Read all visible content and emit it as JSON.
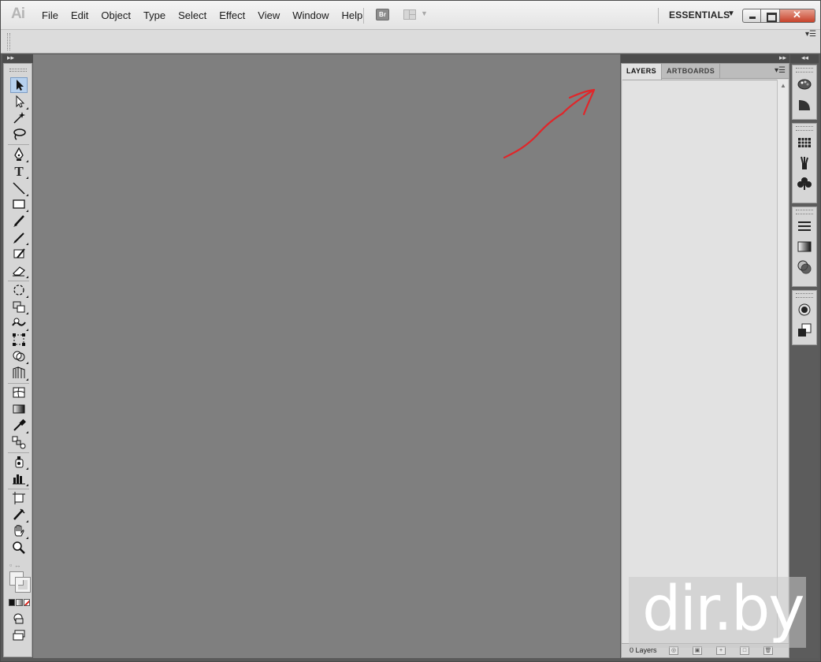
{
  "app": {
    "logo": "Ai",
    "workspace": "ESSENTIALS"
  },
  "menu": [
    "File",
    "Edit",
    "Object",
    "Type",
    "Select",
    "Effect",
    "View",
    "Window",
    "Help"
  ],
  "bridge_button": "Br",
  "window_buttons": {
    "close": "✕"
  },
  "panel": {
    "tabs": [
      "LAYERS",
      "ARTBOARDS"
    ],
    "active_tab": "LAYERS",
    "layers_count": "0 Layers"
  },
  "tools": [
    "selection-tool",
    "direct-selection-tool",
    "magic-wand-tool",
    "lasso-tool",
    "pen-tool",
    "type-tool",
    "line-segment-tool",
    "rectangle-tool",
    "paintbrush-tool",
    "pencil-tool",
    "blob-brush-tool",
    "eraser-tool",
    "rotate-tool",
    "scale-tool",
    "warp-tool",
    "free-transform-tool",
    "shape-builder-tool",
    "perspective-grid-tool",
    "mesh-tool",
    "gradient-tool",
    "eyedropper-tool",
    "blend-tool",
    "symbol-sprayer-tool",
    "column-graph-tool",
    "artboard-tool",
    "slice-tool",
    "hand-tool",
    "zoom-tool"
  ],
  "right_dock_icons": [
    "color-icon",
    "color-guide-icon",
    "swatches-icon",
    "brushes-icon",
    "symbols-icon",
    "stroke-icon",
    "gradient-icon",
    "transparency-icon",
    "appearance-icon",
    "graphic-styles-icon"
  ],
  "annotation": {
    "color": "#e0262a"
  },
  "watermark": "dir.by"
}
